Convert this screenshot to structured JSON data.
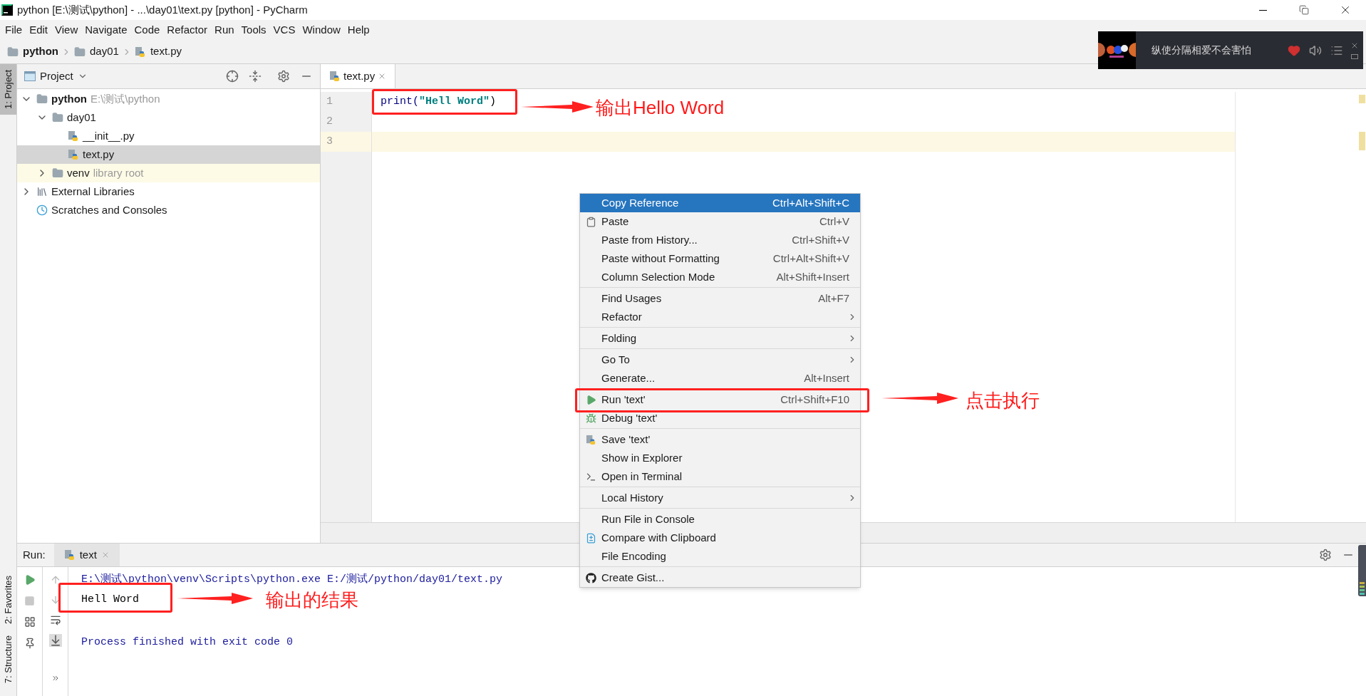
{
  "window": {
    "title": "python [E:\\测试\\python] - ...\\day01\\text.py [python] - PyCharm"
  },
  "menu_bar": [
    "File",
    "Edit",
    "View",
    "Navigate",
    "Code",
    "Refactor",
    "Run",
    "Tools",
    "VCS",
    "Window",
    "Help"
  ],
  "breadcrumb": [
    {
      "label": "python",
      "kind": "folder",
      "bold": true
    },
    {
      "label": "day01",
      "kind": "folder",
      "bold": false
    },
    {
      "label": "text.py",
      "kind": "python-file",
      "bold": false
    }
  ],
  "tool_strip": {
    "top": [
      {
        "label": "1: Project",
        "selected": true
      }
    ],
    "bottom": [
      {
        "label": "2: Favorites",
        "selected": false
      },
      {
        "label": "7: Structure",
        "selected": false
      }
    ]
  },
  "project_panel": {
    "title": "Project",
    "tree": [
      {
        "label": "python",
        "hint": "E:\\测试\\python",
        "kind": "folder",
        "bold": true,
        "expanded": true,
        "selected": false,
        "highlighted": false,
        "children": [
          {
            "label": "day01",
            "kind": "folder",
            "bold": false,
            "expanded": true,
            "selected": false,
            "highlighted": false,
            "children": [
              {
                "label": "__init__.py",
                "kind": "python-file",
                "bold": false,
                "selected": false,
                "highlighted": false
              },
              {
                "label": "text.py",
                "kind": "python-file",
                "bold": false,
                "selected": true,
                "highlighted": false
              }
            ]
          },
          {
            "label": "venv",
            "hint": "library root",
            "kind": "folder",
            "bold": false,
            "expanded": false,
            "selected": false,
            "highlighted": true
          }
        ]
      },
      {
        "label": "External Libraries",
        "kind": "library",
        "bold": false,
        "expanded": false,
        "selected": false,
        "highlighted": false
      },
      {
        "label": "Scratches and Consoles",
        "kind": "scratches",
        "bold": false,
        "selected": false,
        "highlighted": false
      }
    ]
  },
  "editor": {
    "tabs": [
      {
        "label": "text.py",
        "selected": true
      }
    ],
    "lines": [
      {
        "number": "1",
        "current": false,
        "framed": true,
        "tokens": [
          {
            "text": "print(",
            "kind": "builtin"
          },
          {
            "text": "\"Hell Word\"",
            "kind": "string"
          },
          {
            "text": ")",
            "kind": "plain"
          }
        ]
      },
      {
        "number": "2",
        "current": false
      },
      {
        "number": "3",
        "current": true
      }
    ]
  },
  "context_menu": [
    [
      {
        "label": "Copy Reference",
        "shortcut": "Ctrl+Alt+Shift+C",
        "selected": true
      },
      {
        "label": "Paste",
        "shortcut": "Ctrl+V",
        "kind": "paste",
        "selected": false
      },
      {
        "label": "Paste from History...",
        "shortcut": "Ctrl+Shift+V",
        "selected": false
      },
      {
        "label": "Paste without Formatting",
        "shortcut": "Ctrl+Alt+Shift+V",
        "selected": false
      },
      {
        "label": "Column Selection Mode",
        "shortcut": "Alt+Shift+Insert",
        "selected": false
      }
    ],
    [
      {
        "label": "Find Usages",
        "shortcut": "Alt+F7",
        "selected": false
      },
      {
        "label": "Refactor",
        "submenu": true,
        "selected": false
      }
    ],
    [
      {
        "label": "Folding",
        "submenu": true,
        "selected": false
      }
    ],
    [
      {
        "label": "Go To",
        "submenu": true,
        "selected": false
      },
      {
        "label": "Generate...",
        "shortcut": "Alt+Insert",
        "selected": false
      }
    ],
    [
      {
        "label": "Run 'text'",
        "shortcut": "Ctrl+Shift+F10",
        "kind": "run",
        "selected": false
      },
      {
        "label": "Debug 'text'",
        "kind": "debug",
        "selected": false
      }
    ],
    [
      {
        "label": "Save 'text'",
        "kind": "python",
        "selected": false
      },
      {
        "label": "Show in Explorer",
        "selected": false
      },
      {
        "label": "Open in Terminal",
        "kind": "terminal",
        "selected": false
      }
    ],
    [
      {
        "label": "Local History",
        "submenu": true,
        "selected": false
      }
    ],
    [
      {
        "label": "Run File in Console",
        "selected": false
      },
      {
        "label": "Compare with Clipboard",
        "kind": "compare",
        "selected": false
      },
      {
        "label": "File Encoding",
        "selected": false
      }
    ],
    [
      {
        "label": "Create Gist...",
        "kind": "github",
        "selected": false
      }
    ]
  ],
  "run_panel": {
    "label": "Run:",
    "tabs": [
      {
        "label": "text",
        "selected": true
      }
    ],
    "console": [
      {
        "text": "E:\\测试\\python\\venv\\Scripts\\python.exe E:/测试/python/day01/text.py",
        "kind": "command"
      },
      {
        "text": "Hell Word",
        "kind": "output"
      },
      {
        "text": "Process finished with exit code 0",
        "kind": "status"
      }
    ]
  },
  "music_widget": {
    "song": "纵使分隔相爱不会害怕",
    "liked": true
  },
  "annotations": [
    {
      "text": "输出Hello Word"
    },
    {
      "text": "点击执行"
    },
    {
      "text": "输出的结果"
    }
  ]
}
